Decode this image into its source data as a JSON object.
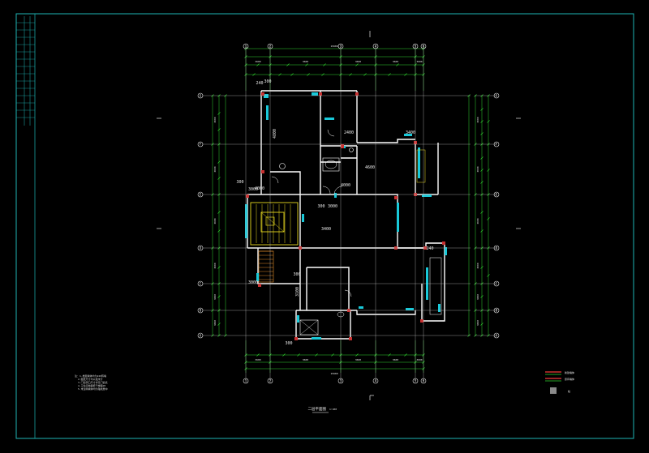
{
  "drawing": {
    "plan_title": "二层平面图",
    "scale": "1:100",
    "colors": {
      "background": "#000000",
      "frame": "#1fb5b5",
      "wall": "#ffffff",
      "dimension": "#2fd42f",
      "axis": "#e6e6e6",
      "window": "#19c9d9",
      "column": "#c93030",
      "stair": "#e6d820"
    },
    "axis_top": [
      "1",
      "2",
      "3",
      "4",
      "5",
      "6"
    ],
    "axis_bottom": [
      "1",
      "2",
      "3",
      "4",
      "5",
      "6"
    ],
    "axis_left": [
      "G",
      "F",
      "E",
      "D",
      "C",
      "B",
      "A"
    ],
    "axis_right": [
      "G",
      "F",
      "E",
      "D",
      "C",
      "B",
      "A"
    ],
    "room_dims": [
      "300",
      "240",
      "4800",
      "4600",
      "300",
      "300",
      "3000",
      "4000",
      "3400",
      "3000",
      "4000",
      "2400",
      "3000",
      "3400",
      "240",
      "300",
      "3100",
      "300"
    ],
    "notes": [
      "注：1.楼层墙体均为240砖墙",
      "2.图纸尺寸均以毫米计",
      "3.门窗洞口尺寸详见门窗表",
      "4.卫生间地面低于楼面20",
      "5.未注明墙体均为轴线居中"
    ],
    "legend": [
      "新建墙体",
      "原有墙体",
      "柱"
    ]
  }
}
